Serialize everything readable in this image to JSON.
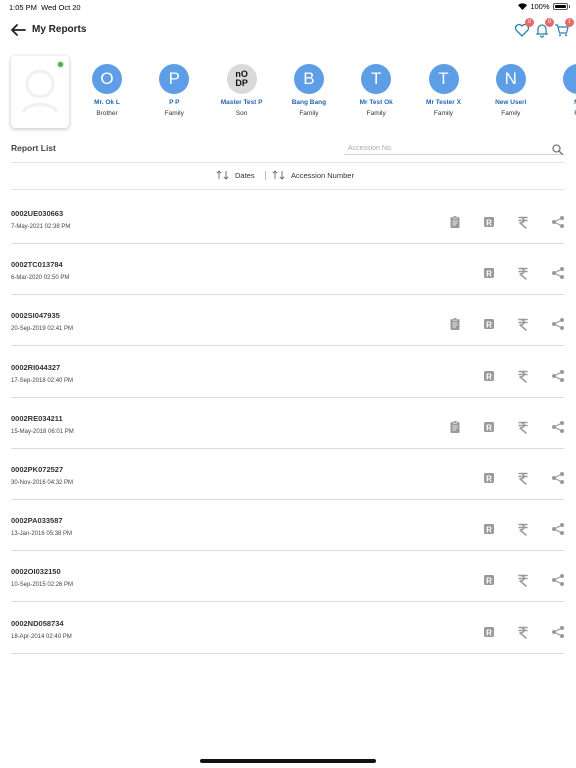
{
  "status": {
    "time": "1:05 PM",
    "date": "Wed Oct 20",
    "battery": "100%"
  },
  "header": {
    "title": "My Reports",
    "badges": {
      "favorites": "0",
      "notifications": "0",
      "cart": "1"
    }
  },
  "members": [
    {
      "initial": "O",
      "name": "Mr. Ok L",
      "relation": "Brother",
      "gray": false
    },
    {
      "initial": "P",
      "name": "P P",
      "relation": "Family",
      "gray": false
    },
    {
      "initial": "nO\nDP",
      "name": "Master Test P",
      "relation": "Son",
      "gray": true
    },
    {
      "initial": "B",
      "name": "Bang Bang",
      "relation": "Family",
      "gray": false
    },
    {
      "initial": "T",
      "name": "Mr Test Ok",
      "relation": "Family",
      "gray": false
    },
    {
      "initial": "T",
      "name": "Mr Tester X",
      "relation": "Family",
      "gray": false
    },
    {
      "initial": "N",
      "name": "New Useri",
      "relation": "Family",
      "gray": false
    },
    {
      "initial": "",
      "name": "Mr",
      "relation": "Fa",
      "gray": false
    }
  ],
  "report_list": {
    "title": "Report List",
    "search_placeholder": "Accession No.",
    "sort_dates": "Dates",
    "sort_accession": "Accession Number"
  },
  "reports": [
    {
      "id": "0002UE030663",
      "date": "7-May-2021 02:38 PM",
      "has_clipboard": true
    },
    {
      "id": "0002TC013784",
      "date": "6-Mar-2020 02:50 PM",
      "has_clipboard": false
    },
    {
      "id": "0002SI047935",
      "date": "20-Sep-2019 02:41 PM",
      "has_clipboard": true
    },
    {
      "id": "0002RI044327",
      "date": "17-Sep-2018 02:40 PM",
      "has_clipboard": false
    },
    {
      "id": "0002RE034211",
      "date": "15-May-2018 06:01 PM",
      "has_clipboard": true
    },
    {
      "id": "0002PK072527",
      "date": "30-Nov-2016 04:32 PM",
      "has_clipboard": false
    },
    {
      "id": "0002PA033587",
      "date": "13-Jan-2016 05:38 PM",
      "has_clipboard": false
    },
    {
      "id": "0002OI032150",
      "date": "10-Sep-2015 02:26 PM",
      "has_clipboard": false
    },
    {
      "id": "0002ND058734",
      "date": "18-Apr-2014 02:40 PM",
      "has_clipboard": false
    }
  ],
  "colors": {
    "accent": "#5d9ee6",
    "link": "#2067b6",
    "badge": "#e76a6a",
    "icon": "#9a9a9a"
  }
}
